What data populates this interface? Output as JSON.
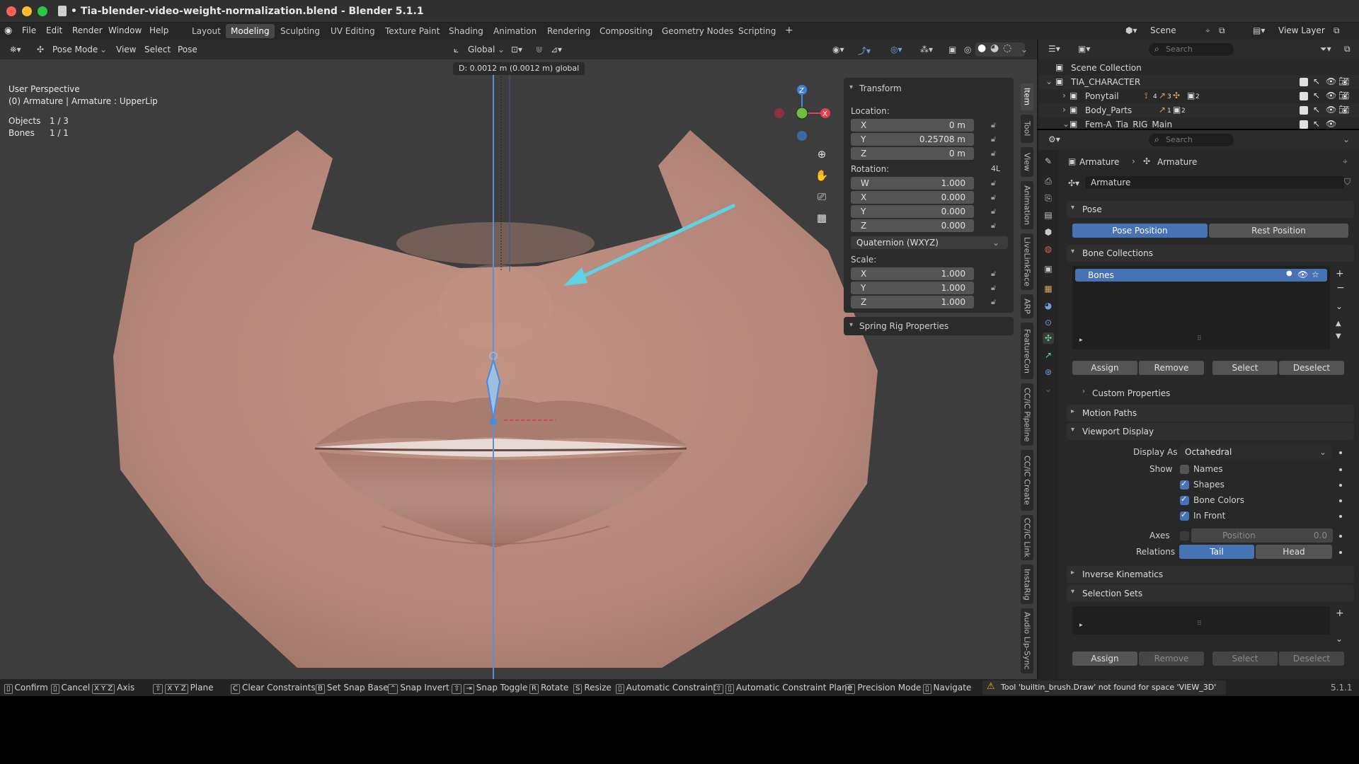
{
  "window": {
    "title": "• Tia-blender-video-weight-normalization.blend - Blender 5.1.1"
  },
  "menu": {
    "items": [
      "File",
      "Edit",
      "Render",
      "Window",
      "Help"
    ],
    "workspaces": [
      "Layout",
      "Modeling",
      "Sculpting",
      "UV Editing",
      "Texture Paint",
      "Shading",
      "Animation",
      "Rendering",
      "Compositing",
      "Geometry Nodes",
      "Scripting"
    ],
    "active_workspace": "Modeling",
    "scene": "Scene",
    "view_layer": "View Layer"
  },
  "viewport_header": {
    "mode": "Pose Mode",
    "menus": [
      "View",
      "Select",
      "Pose"
    ],
    "orientation": "Global"
  },
  "viewport": {
    "drag_info": "D:  0.0012 m (0.0012 m) global",
    "perspective": "User Perspective",
    "context": "(0) Armature | Armature : UpperLip",
    "objects_label": "Objects",
    "objects_value": "1 / 3",
    "bones_label": "Bones",
    "bones_value": "1 / 1"
  },
  "npanel": {
    "transform_title": "Transform",
    "location_label": "Location:",
    "location": [
      {
        "axis": "X",
        "value": "0 m"
      },
      {
        "axis": "Y",
        "value": "0.25708 m"
      },
      {
        "axis": "Z",
        "value": "0 m"
      }
    ],
    "rotation_label": "Rotation:",
    "rotation_lock_label": "4L",
    "rotation": [
      {
        "axis": "W",
        "value": "1.000"
      },
      {
        "axis": "X",
        "value": "0.000"
      },
      {
        "axis": "Y",
        "value": "0.000"
      },
      {
        "axis": "Z",
        "value": "0.000"
      }
    ],
    "rotation_mode": "Quaternion (WXYZ)",
    "scale_label": "Scale:",
    "scale": [
      {
        "axis": "X",
        "value": "1.000"
      },
      {
        "axis": "Y",
        "value": "1.000"
      },
      {
        "axis": "Z",
        "value": "1.000"
      }
    ],
    "spring_rig_title": "Spring Rig Properties"
  },
  "side_tabs": [
    "Item",
    "Tool",
    "View",
    "Animation",
    "LiveLinkFace",
    "ARP",
    "FeatureCon",
    "CC/iC Pipeline",
    "CC/iC Create",
    "CC/iC Link",
    "InstaRig",
    "Audio Lip-Sync"
  ],
  "outliner": {
    "search_placeholder": "Search",
    "rows": [
      {
        "label": "Scene Collection"
      },
      {
        "label": "TIA_CHARACTER"
      },
      {
        "label": "Ponytail",
        "badges": [
          "4",
          "3",
          "2"
        ]
      },
      {
        "label": "Body_Parts",
        "badges": [
          "1",
          "2"
        ]
      },
      {
        "label": "Fem-A_Tia_RIG_Main"
      }
    ]
  },
  "properties": {
    "search_placeholder": "Search",
    "breadcrumb": [
      "Armature",
      "Armature"
    ],
    "data_name": "Armature",
    "pose_title": "Pose",
    "pose_position": "Pose Position",
    "rest_position": "Rest Position",
    "bone_collections_title": "Bone Collections",
    "bone_collection_item": "Bones",
    "bc_buttons": [
      "Assign",
      "Remove",
      "Select",
      "Deselect"
    ],
    "custom_properties": "Custom Properties",
    "motion_paths": "Motion Paths",
    "viewport_display": "Viewport Display",
    "display_as_label": "Display As",
    "display_as_value": "Octahedral",
    "show_label": "Show",
    "show_options": [
      {
        "label": "Names",
        "checked": false
      },
      {
        "label": "Shapes",
        "checked": true
      },
      {
        "label": "Bone Colors",
        "checked": true
      },
      {
        "label": "In Front",
        "checked": true
      }
    ],
    "axes_label": "Axes",
    "axes_position_label": "Position",
    "axes_position_value": "0.0",
    "relations_label": "Relations",
    "relations_tail": "Tail",
    "relations_head": "Head",
    "inverse_kinematics": "Inverse Kinematics",
    "selection_sets": "Selection Sets",
    "ss_buttons": [
      "Assign",
      "Remove",
      "Select",
      "Deselect"
    ]
  },
  "statusbar": {
    "items": [
      "Confirm",
      "Cancel",
      "Axis",
      "Plane",
      "Clear Constraints",
      "Set Snap Base",
      "Snap Invert",
      "Snap Toggle",
      "Rotate",
      "Resize",
      "Automatic Constraint",
      "Automatic Constraint Plane",
      "Precision Mode",
      "Navigate"
    ],
    "keys": [
      "",
      "",
      "X Y Z",
      "X Y Z",
      "C",
      "B",
      "",
      "",
      "R",
      "S",
      "",
      "",
      "",
      ""
    ],
    "warning": "Tool 'builtin_brush.Draw' not found for space 'VIEW_3D'",
    "version": "5.1.1"
  },
  "colors": {
    "accent_blue": "#4772b3",
    "skin": "#b98a7a",
    "background": "#3d3d3d",
    "annotation_arrow": "#5fd3e6"
  }
}
